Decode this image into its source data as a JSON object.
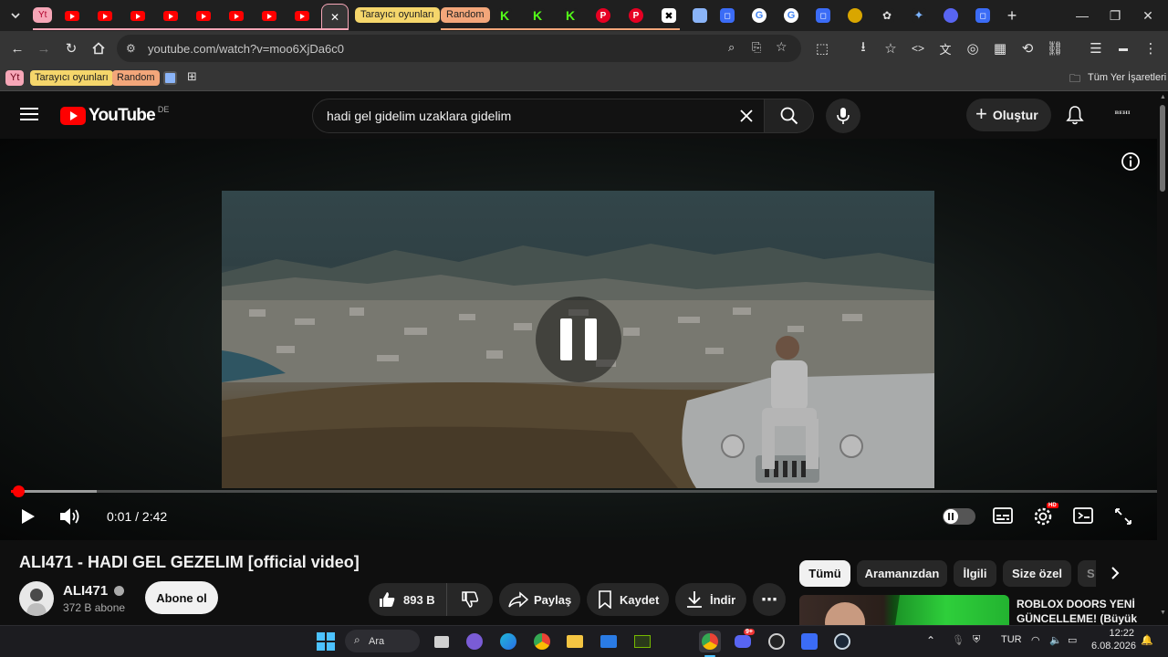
{
  "browser": {
    "tab_groups": [
      {
        "label": "Tarayıcı oyunları",
        "color": "#f5d66b"
      },
      {
        "label": "Random",
        "color": "#f3a67a"
      }
    ],
    "first_group_label": "Yt",
    "url": "youtube.com/watch?v=moo6XjDa6c0",
    "bookmarks": {
      "group1": "Yt",
      "group2": "Tarayıcı oyunları",
      "group3": "Random",
      "all_bookmarks": "Tüm Yer İşaretleri"
    }
  },
  "youtube": {
    "logo_text": "YouTube",
    "country_code": "DE",
    "search_query": "hadi gel gidelim uzaklara gidelim",
    "create_label": "Oluştur",
    "player": {
      "current_time": "0:01",
      "duration": "2:42",
      "time_display": "0:01 / 2:42",
      "played_fraction": 0.006,
      "loaded_fraction": 0.075,
      "quality_badge": "HD"
    },
    "video": {
      "title": "ALI471 - HADI GEL GEZELIM [official video]",
      "channel": "ALI471",
      "subscribers": "372 B abone",
      "subscribe_label": "Abone ol",
      "likes": "893 B",
      "share_label": "Paylaş",
      "save_label": "Kaydet",
      "download_label": "İndir"
    },
    "chips": [
      "Tümü",
      "Aramanızdan",
      "İlgili",
      "Size özel",
      "S"
    ],
    "recommendation_title": "ROBLOX DOORS YENİ GÜNCELLEME! (Büyük"
  },
  "taskbar": {
    "search_label": "Ara",
    "language": "TUR",
    "time": "12:22",
    "date": "6.08.2026",
    "discord_badge": "9+"
  },
  "colors": {
    "yt_red": "#ff0000",
    "bg": "#0f0f0f",
    "chip_bg": "#272727",
    "subscribe_bg": "#f1f1f1"
  }
}
